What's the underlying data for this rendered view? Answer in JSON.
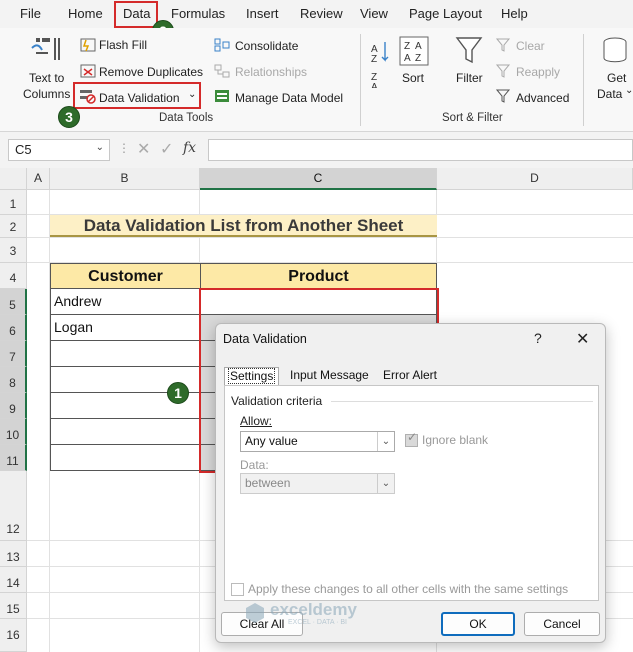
{
  "menu": {
    "items": [
      "File",
      "Home",
      "Data",
      "Formulas",
      "Insert",
      "Review",
      "View",
      "Page Layout",
      "Help"
    ]
  },
  "ribbon": {
    "text_to_columns": "Text to\nColumns",
    "text_to": "Text to",
    "columns": "Columns",
    "flash_fill": "Flash Fill",
    "remove_duplicates": "Remove Duplicates",
    "data_validation": "Data Validation",
    "consolidate": "Consolidate",
    "relationships": "Relationships",
    "manage_data_model": "Manage Data Model",
    "data_tools_label": "Data Tools",
    "sort": "Sort",
    "filter": "Filter",
    "clear": "Clear",
    "reapply": "Reapply",
    "advanced": "Advanced",
    "sort_filter_label": "Sort & Filter",
    "get": "Get",
    "data": "Data"
  },
  "badges": {
    "b1": "1",
    "b2": "2",
    "b3": "3"
  },
  "formula_bar": {
    "name_box": "C5",
    "fx": "fx"
  },
  "columns": [
    "A",
    "B",
    "C",
    "D"
  ],
  "rows": [
    "1",
    "2",
    "3",
    "4",
    "5",
    "6",
    "7",
    "8",
    "9",
    "10",
    "11",
    "12",
    "13",
    "14",
    "15",
    "16"
  ],
  "sheet": {
    "title": "Data Validation List from Another Sheet",
    "headers": {
      "customer": "Customer",
      "product": "Product"
    },
    "customers": [
      "Andrew",
      "Logan",
      "",
      "",
      "",
      "",
      ""
    ]
  },
  "dialog": {
    "title": "Data Validation",
    "help": "?",
    "close": "✕",
    "tabs": [
      "Settings",
      "Input Message",
      "Error Alert"
    ],
    "criteria_label": "Validation criteria",
    "allow_label": "Allow:",
    "allow_value": "Any value",
    "ignore_blank": "Ignore blank",
    "data_label": "Data:",
    "data_value": "between",
    "apply_all": "Apply these changes to all other cells with the same settings",
    "clear_all": "Clear All",
    "ok": "OK",
    "cancel": "Cancel"
  },
  "watermark": {
    "brand": "exceldemy",
    "tagline": "EXCEL · DATA · BI"
  }
}
